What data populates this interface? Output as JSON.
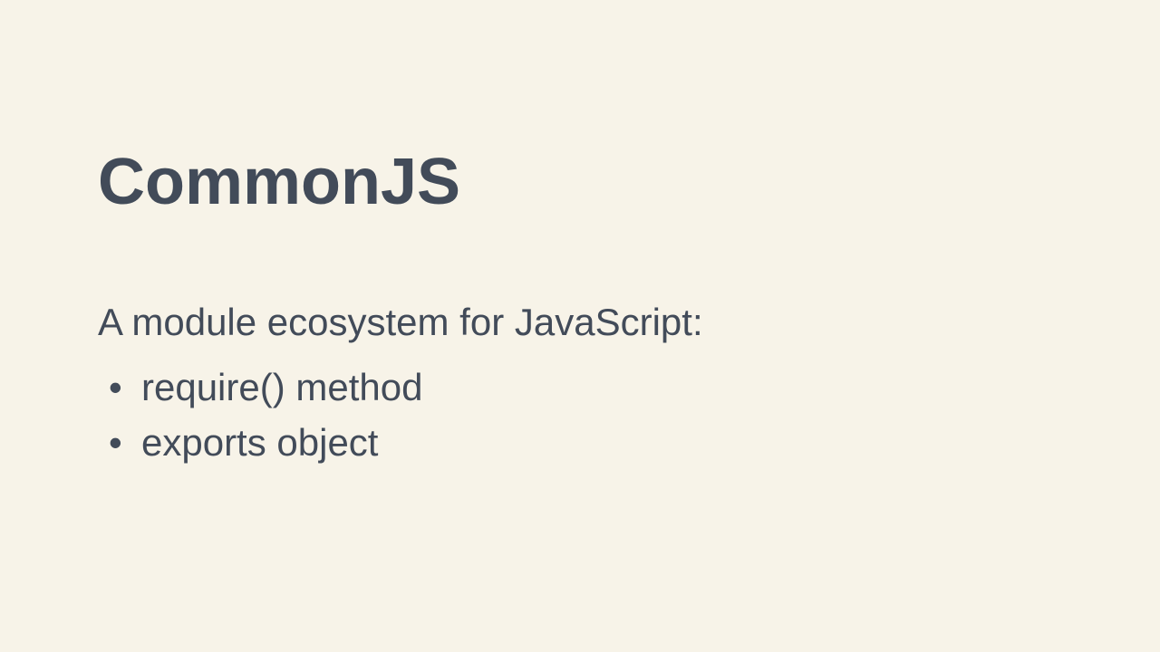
{
  "slide": {
    "title": "CommonJS",
    "subtitle": "A module ecosystem for JavaScript:",
    "bullets": [
      "require() method",
      "exports object"
    ]
  }
}
